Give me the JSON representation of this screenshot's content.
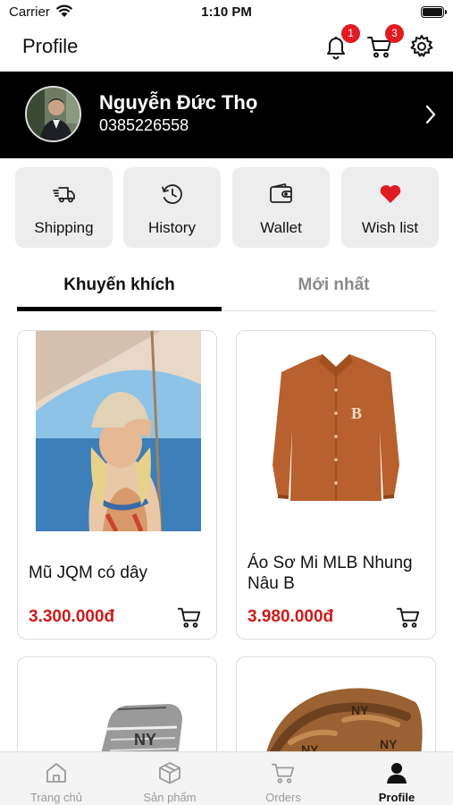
{
  "status_bar": {
    "carrier": "Carrier",
    "time": "1:10 PM"
  },
  "header": {
    "title": "Profile",
    "notifications_badge": "1",
    "cart_badge": "3",
    "icons": [
      "bell-icon",
      "cart-icon",
      "gear-icon"
    ]
  },
  "profile": {
    "name": "Nguyễn Đức Thọ",
    "phone": "0385226558"
  },
  "actions": [
    {
      "label": "Shipping",
      "icon": "truck-icon"
    },
    {
      "label": "History",
      "icon": "history-icon"
    },
    {
      "label": "Wallet",
      "icon": "wallet-icon"
    },
    {
      "label": "Wish list",
      "icon": "heart-icon"
    }
  ],
  "tabs": [
    {
      "label": "Khuyến khích",
      "active": true
    },
    {
      "label": "Mới nhất",
      "active": false
    }
  ],
  "products": [
    {
      "name": "Mũ JQM có dây",
      "price": "3.300.000đ"
    },
    {
      "name": "Áo Sơ Mi MLB Nhung Nâu B",
      "price": "3.980.000đ"
    }
  ],
  "bottom_nav": [
    {
      "label": "Trang chủ",
      "icon": "home-icon",
      "active": false
    },
    {
      "label": "Sản phẩm",
      "icon": "box-icon",
      "active": false
    },
    {
      "label": "Orders",
      "icon": "cart-icon",
      "active": false
    },
    {
      "label": "Profile",
      "icon": "user-icon",
      "active": true
    }
  ],
  "colors": {
    "accent": "#e11b22",
    "price": "#d01a1a",
    "banner": "#000000",
    "card_bg": "#ededed"
  }
}
